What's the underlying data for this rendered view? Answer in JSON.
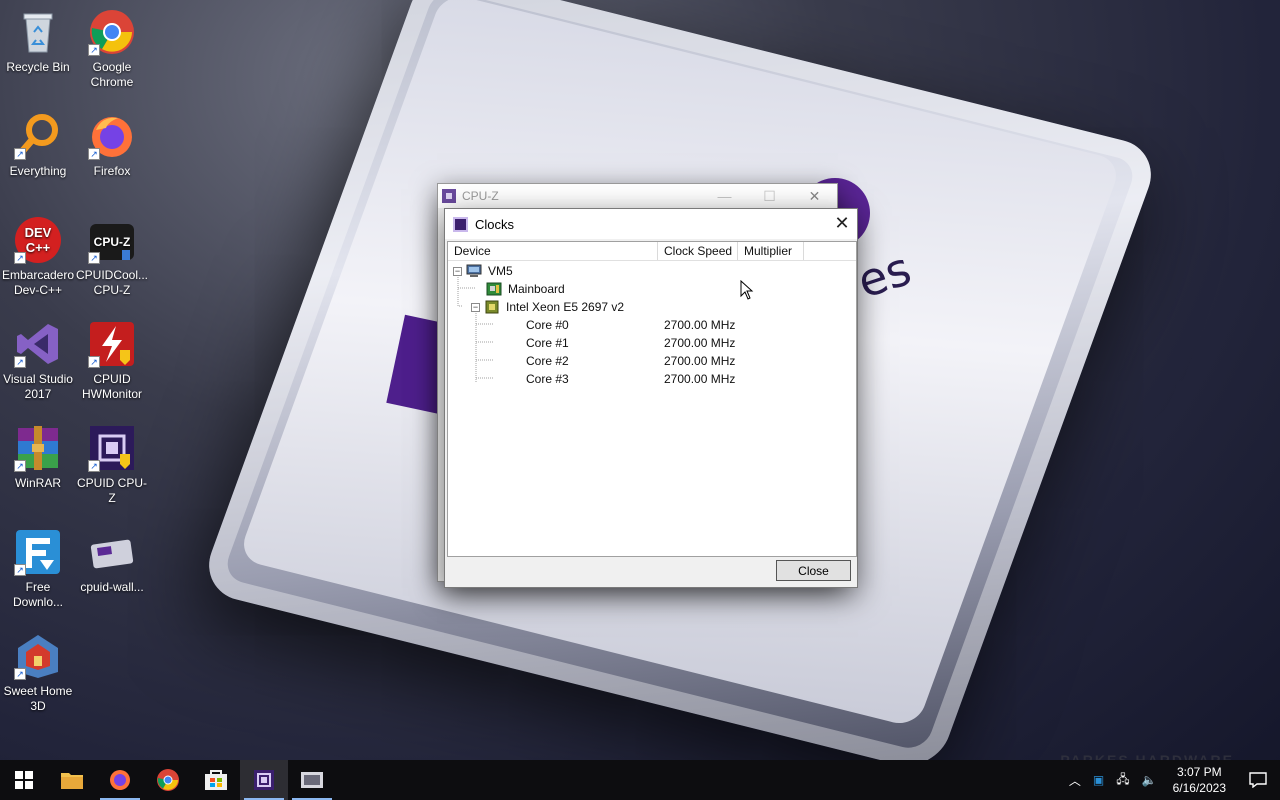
{
  "desktop": {
    "icons": [
      {
        "label": "Recycle Bin"
      },
      {
        "label": "Google Chrome"
      },
      {
        "label": "Everything"
      },
      {
        "label": "Firefox"
      },
      {
        "label": "Embarcadero Dev-C++"
      },
      {
        "label": "CPUIDCool... CPU-Z"
      },
      {
        "label": "Visual Studio 2017"
      },
      {
        "label": "CPUID HWMonitor"
      },
      {
        "label": "WinRAR"
      },
      {
        "label": "CPUID CPU-Z"
      },
      {
        "label": "Free Downlo..."
      },
      {
        "label": "cpuid-wall..."
      },
      {
        "label": "Sweet Home 3D"
      }
    ],
    "wallpaper_text": "es",
    "watermark": "PARKES HARDWARE"
  },
  "cpuz_window": {
    "title": "CPU-Z"
  },
  "clocks_dialog": {
    "title": "Clocks",
    "columns": [
      "Device",
      "Clock Speed",
      "Multiplier"
    ],
    "tree": {
      "root": "VM5",
      "mainboard": "Mainboard",
      "cpu": "Intel Xeon E5 2697 v2",
      "cores": [
        {
          "name": "Core #0",
          "speed": "2700.00 MHz"
        },
        {
          "name": "Core #1",
          "speed": "2700.00 MHz"
        },
        {
          "name": "Core #2",
          "speed": "2700.00 MHz"
        },
        {
          "name": "Core #3",
          "speed": "2700.00 MHz"
        }
      ]
    },
    "close_label": "Close"
  },
  "taskbar": {
    "time": "3:07 PM",
    "date": "6/16/2023"
  },
  "colors": {
    "taskbar_bg": "#0d0d10",
    "accent_underline": "#8bb7f0",
    "cpuz_purple": "#3b1f6e"
  }
}
